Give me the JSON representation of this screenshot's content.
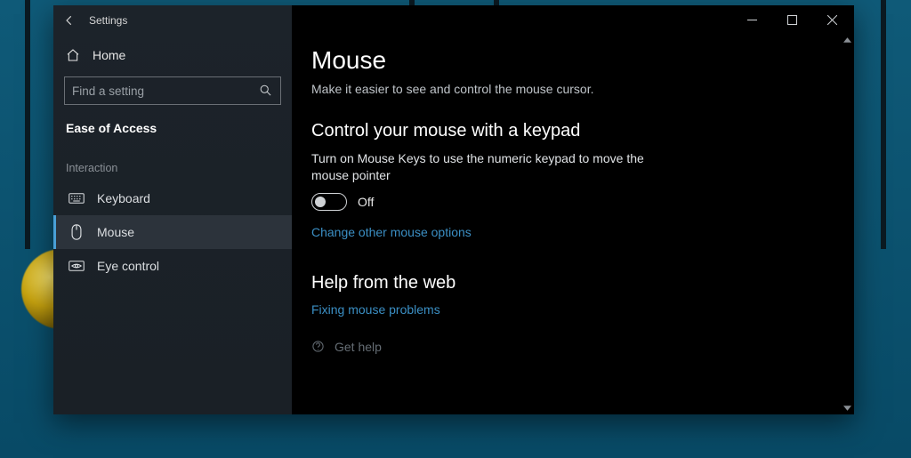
{
  "window": {
    "title": "Settings"
  },
  "sidebar": {
    "home_label": "Home",
    "search_placeholder": "Find a setting",
    "category_title": "Ease of Access",
    "group_label": "Interaction",
    "items": [
      {
        "id": "keyboard",
        "label": "Keyboard",
        "icon": "keyboard-icon",
        "selected": false
      },
      {
        "id": "mouse",
        "label": "Mouse",
        "icon": "mouse-icon",
        "selected": true
      },
      {
        "id": "eye-control",
        "label": "Eye control",
        "icon": "eye-icon",
        "selected": false
      }
    ]
  },
  "page": {
    "title": "Mouse",
    "subtitle": "Make it easier to see and control the mouse cursor.",
    "section1_title": "Control your mouse with a keypad",
    "section1_desc": "Turn on Mouse Keys to use the numeric keypad to move the mouse pointer",
    "toggle_state": "Off",
    "toggle_on": false,
    "link_other_options": "Change other mouse options",
    "help_title": "Help from the web",
    "help_link": "Fixing mouse problems",
    "get_help_label": "Get help"
  }
}
